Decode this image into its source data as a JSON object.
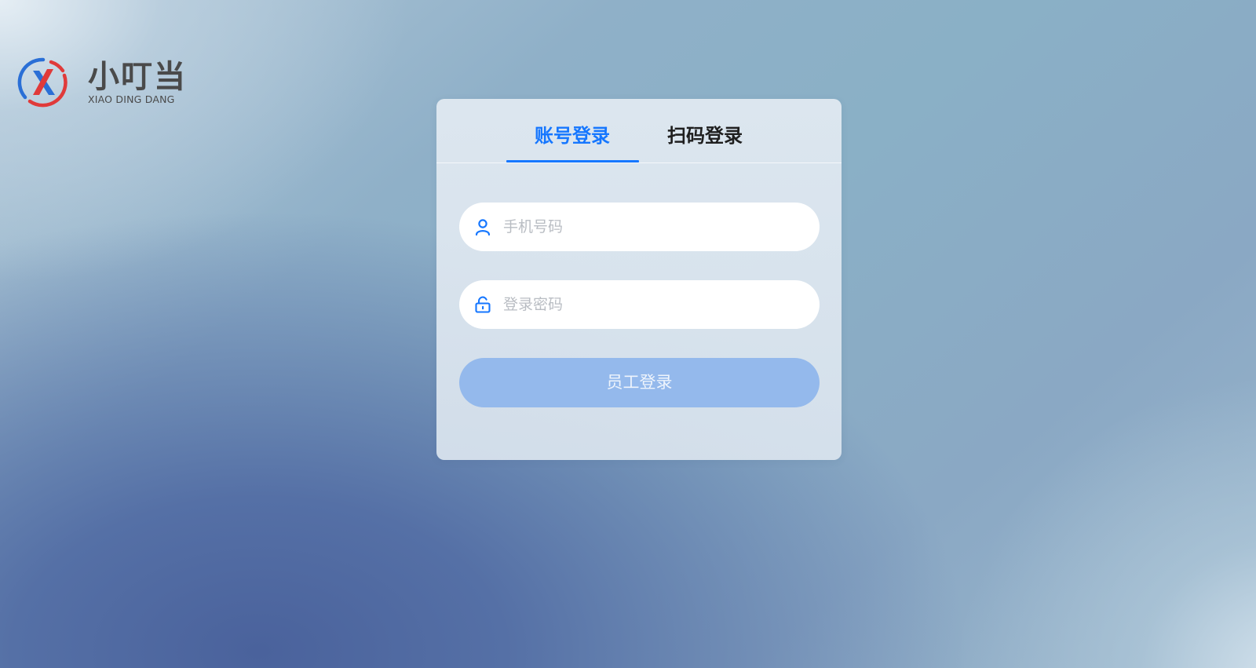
{
  "brand": {
    "name_cn": "小叮当",
    "name_en": "XIAO DING DANG",
    "logo_icon": "x-circle-logo-icon"
  },
  "login": {
    "tabs": [
      {
        "label": "账号登录",
        "active": true
      },
      {
        "label": "扫码登录",
        "active": false
      }
    ],
    "phone": {
      "placeholder": "手机号码",
      "value": "",
      "icon": "user-icon"
    },
    "password": {
      "placeholder": "登录密码",
      "value": "",
      "icon": "lock-icon"
    },
    "submit_label": "员工登录"
  },
  "colors": {
    "accent": "#1677ff",
    "button_disabled": "#94b9ec"
  }
}
